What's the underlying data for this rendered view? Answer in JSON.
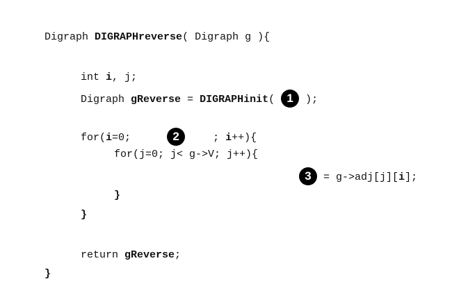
{
  "code": {
    "line1": {
      "a": "Digraph ",
      "b": "DIGRAPHreverse",
      "c": "( Digraph g ){"
    },
    "line2": {
      "a": "int ",
      "b": "i",
      "c": ", j;"
    },
    "line3": {
      "a": "Digraph ",
      "b": "gReverse",
      "c": " = ",
      "d": "DIGRAPHinit",
      "e": "( ",
      "badge": "1",
      "f": " );"
    },
    "line4": {
      "a": "for(",
      "b": "i",
      "c": "=0;",
      "badge": "2",
      "d": "; ",
      "e": "i",
      "f": "++){"
    },
    "line5": {
      "a": "for(j=0; j< g->V; j++){"
    },
    "line6": {
      "badge": "3",
      "a": " = g->adj[j][",
      "b": "i",
      "c": "];"
    },
    "line7": {
      "a": "}"
    },
    "line8": {
      "a": "}"
    },
    "line9": {
      "a": "return ",
      "b": "gReverse",
      "c": ";"
    },
    "line10": {
      "a": "}"
    }
  }
}
